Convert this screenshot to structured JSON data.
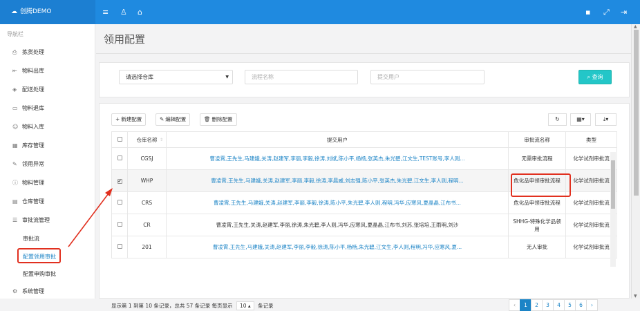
{
  "topbar": {
    "brand": "创腾DEMO",
    "icons": [
      "cloud-icon",
      "menu-icon",
      "users-icon",
      "home-icon",
      "file-icon",
      "expand-icon",
      "logout-icon"
    ]
  },
  "sidebar": {
    "header": "导航栏",
    "items": [
      {
        "label": "拣货处理",
        "icon": "print-icon"
      },
      {
        "label": "物料出库",
        "icon": "signout-icon"
      },
      {
        "label": "配送处理",
        "icon": "layers-icon"
      },
      {
        "label": "物料退库",
        "icon": "monitor-icon"
      },
      {
        "label": "物料入库",
        "icon": "person-icon"
      },
      {
        "label": "库存管理",
        "icon": "grid-icon"
      },
      {
        "label": "领用异常",
        "icon": "wrench-icon"
      },
      {
        "label": "物料管理",
        "icon": "info-icon"
      },
      {
        "label": "仓库管理",
        "icon": "table-icon"
      },
      {
        "label": "审批流管理",
        "icon": "list-icon"
      }
    ],
    "sub_items": [
      "审批流",
      "配置领用审批",
      "配置申购审批"
    ],
    "bottom_item": {
      "label": "系统管理",
      "icon": "gear-icon"
    }
  },
  "page": {
    "title": "领用配置"
  },
  "search": {
    "warehouse_select": "请选择仓库",
    "flow_name_placeholder": "流程名称",
    "submit_user_placeholder": "提交用户",
    "query_button": "查询"
  },
  "toolbar": {
    "new_label": "新建配置",
    "edit_label": "编辑配置",
    "delete_label": "删除配置"
  },
  "table": {
    "headers": {
      "warehouse": "仓库名称",
      "users": "提交用户",
      "flow": "审批流名称",
      "type": "类型"
    },
    "rows": [
      {
        "checked": false,
        "warehouse": "CGSJ",
        "users": "曹凌霄,王先生,马建娥,关涛,赵建军,李丽,李毅,徐涛,刘斌,陈小平,杨杨,张英杰,朱光碧,江文生,TEST账号,李人则...",
        "flow": "无需审批流程",
        "type": "化学试剂审批流",
        "users_link": true
      },
      {
        "checked": true,
        "warehouse": "WHP",
        "users": "曹凌霄,王先生,马建娥,关涛,赵建军,李丽,李毅,徐涛,李晨威,刘志强,陈小平,张英杰,朱光碧,江文生,李人则,程明...",
        "flow": "危化品申领审批流程",
        "type": "化学试剂审批流",
        "users_link": true
      },
      {
        "checked": false,
        "warehouse": "CRS",
        "users": "曹凌霄,王先生,马建娥,关涛,赵建军,李丽,李毅,徐涛,陈小平,朱光碧,李人则,程明,冯华,应寒风,夏晶晶,江布书...",
        "flow": "危化品申领审批流程",
        "type": "化学试剂审批流",
        "users_link": true
      },
      {
        "checked": false,
        "warehouse": "CR",
        "users": "曹凌霄,王先生,关涛,赵建军,李丽,徐涛,朱光碧,李人则,冯华,应寒风,夏晶晶,江布书,刘苏,张培培,王雨明,刘沙",
        "flow": "SHHG-特殊化学品领用",
        "type": "化学试剂审批流",
        "users_link": false
      },
      {
        "checked": false,
        "warehouse": "201",
        "users": "曹凌霄,王先生,马建娥,关涛,赵建军,李丽,李毅,徐涛,陈小平,杨杨,朱光碧,江文生,李人则,程明,冯华,应寒风,夏...",
        "flow": "无人审批",
        "type": "化学试剂审批流",
        "users_link": true
      }
    ]
  },
  "pagination": {
    "summary_prefix": "显示第 1 到第 10 条记录，总共 57 条记录 每页显示",
    "page_size": "10",
    "summary_suffix": "条记录",
    "prev": "‹",
    "pages": [
      "1",
      "2",
      "3",
      "4",
      "5",
      "6"
    ],
    "next": "›",
    "current": "1"
  },
  "colors": {
    "topbar": "#1f8ae0",
    "link": "#1c84c6",
    "query_button": "#23c6c8",
    "annotation_red": "#e1301f"
  }
}
